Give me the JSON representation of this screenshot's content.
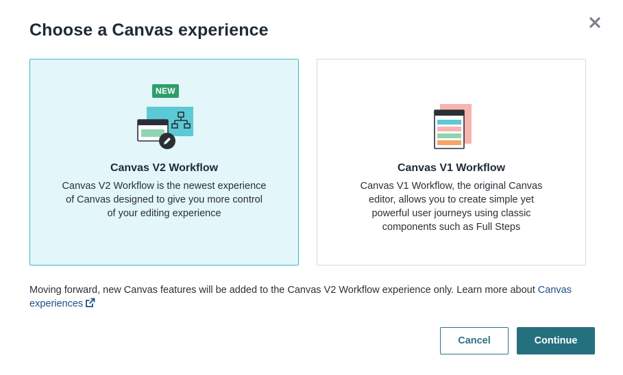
{
  "dialog": {
    "title": "Choose a Canvas experience",
    "close_icon": "close-icon"
  },
  "options": [
    {
      "badge": "NEW",
      "title": "Canvas V2 Workflow",
      "description": "Canvas V2 Workflow is the newest experience of Canvas designed to give you more control of your editing experience",
      "selected": true,
      "illustration": "flow-editor-illustration"
    },
    {
      "title": "Canvas V1 Workflow",
      "description": "Canvas V1 Workflow, the original Canvas editor, allows you to create simple yet powerful user journeys using classic components such as Full Steps",
      "selected": false,
      "illustration": "steps-list-illustration"
    }
  ],
  "footer": {
    "note": "Moving forward, new Canvas features will be added to the Canvas V2 Workflow experience only. Learn more about ",
    "link_text": "Canvas experiences",
    "link_icon": "external-link-icon"
  },
  "buttons": {
    "cancel": "Cancel",
    "continue": "Continue"
  },
  "colors": {
    "selected_border": "#3db7c5",
    "selected_bg": "#e3f6f9",
    "primary": "#25707e",
    "badge": "#2f9e6a",
    "link": "#1b4f8a"
  }
}
